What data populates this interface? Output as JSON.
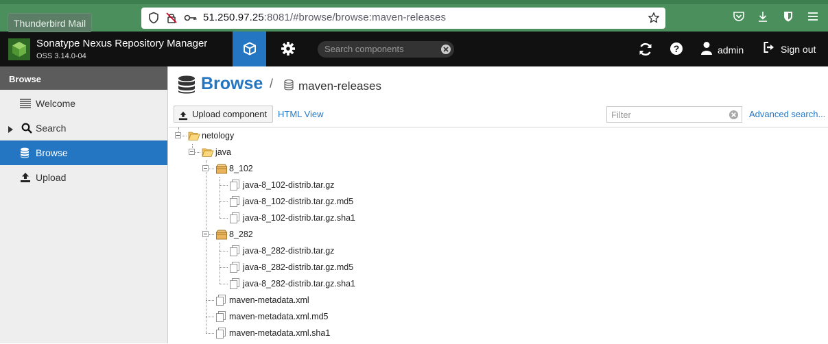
{
  "browser": {
    "tooltip": "Thunderbird Mail",
    "url_host": "51.250.97.25",
    "url_rest": ":8081/#browse/browse:maven-releases"
  },
  "header": {
    "app_title": "Sonatype Nexus Repository Manager",
    "app_version": "OSS 3.14.0-04",
    "search_placeholder": "Search components",
    "user": "admin",
    "signout": "Sign out"
  },
  "sidebar": {
    "title": "Browse",
    "items": [
      {
        "label": "Welcome",
        "icon": "list-icon"
      },
      {
        "label": "Search",
        "icon": "search-icon"
      },
      {
        "label": "Browse",
        "icon": "database-icon",
        "active": true
      },
      {
        "label": "Upload",
        "icon": "upload-icon"
      }
    ]
  },
  "main": {
    "title": "Browse",
    "separator": "/",
    "repository": "maven-releases",
    "upload_label": "Upload component",
    "html_view": "HTML View",
    "filter_placeholder": "Filter",
    "advanced_search": "Advanced search..."
  },
  "tree": [
    {
      "label": "netology",
      "type": "folder-open"
    },
    {
      "label": "java",
      "type": "folder-open"
    },
    {
      "label": "8_102",
      "type": "component"
    },
    {
      "label": "java-8_102-distrib.tar.gz",
      "type": "file"
    },
    {
      "label": "java-8_102-distrib.tar.gz.md5",
      "type": "file"
    },
    {
      "label": "java-8_102-distrib.tar.gz.sha1",
      "type": "file"
    },
    {
      "label": "8_282",
      "type": "component"
    },
    {
      "label": "java-8_282-distrib.tar.gz",
      "type": "file"
    },
    {
      "label": "java-8_282-distrib.tar.gz.md5",
      "type": "file"
    },
    {
      "label": "java-8_282-distrib.tar.gz.sha1",
      "type": "file"
    },
    {
      "label": "maven-metadata.xml",
      "type": "file"
    },
    {
      "label": "maven-metadata.xml.md5",
      "type": "file"
    },
    {
      "label": "maven-metadata.xml.sha1",
      "type": "file"
    }
  ],
  "colors": {
    "accent": "#2476c3",
    "header_bg": "#111111",
    "browser_bg": "#4a8f5c"
  }
}
